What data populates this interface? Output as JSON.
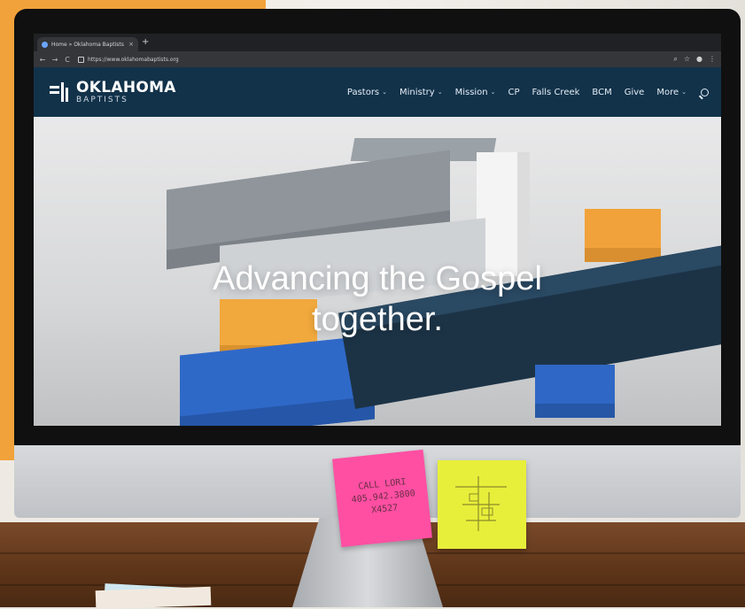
{
  "browser": {
    "tab_title": "Home » Oklahoma Baptists",
    "tab_close": "×",
    "new_tab": "+",
    "address": "https://www.oklahomabaptists.org"
  },
  "site": {
    "logo_line1": "OKLAHOMA",
    "logo_line2": "BAPTISTS",
    "nav_items": [
      {
        "label": "Pastors",
        "dropdown": true
      },
      {
        "label": "Ministry",
        "dropdown": true
      },
      {
        "label": "Mission",
        "dropdown": true
      },
      {
        "label": "CP",
        "dropdown": false
      },
      {
        "label": "Falls Creek",
        "dropdown": false
      },
      {
        "label": "BCM",
        "dropdown": false
      },
      {
        "label": "Give",
        "dropdown": false
      },
      {
        "label": "More",
        "dropdown": true
      }
    ],
    "hero_title_line1": "Advancing the Gospel",
    "hero_title_line2": "together."
  },
  "sticky_notes": {
    "pink_line1": "CALL LORI",
    "pink_line2": "405.942.3800 X4527"
  },
  "colors": {
    "header_bg": "#12324a",
    "accent_orange": "#f2a23a",
    "note_pink": "#ff4fa3",
    "note_yellow": "#e8ef3a"
  }
}
